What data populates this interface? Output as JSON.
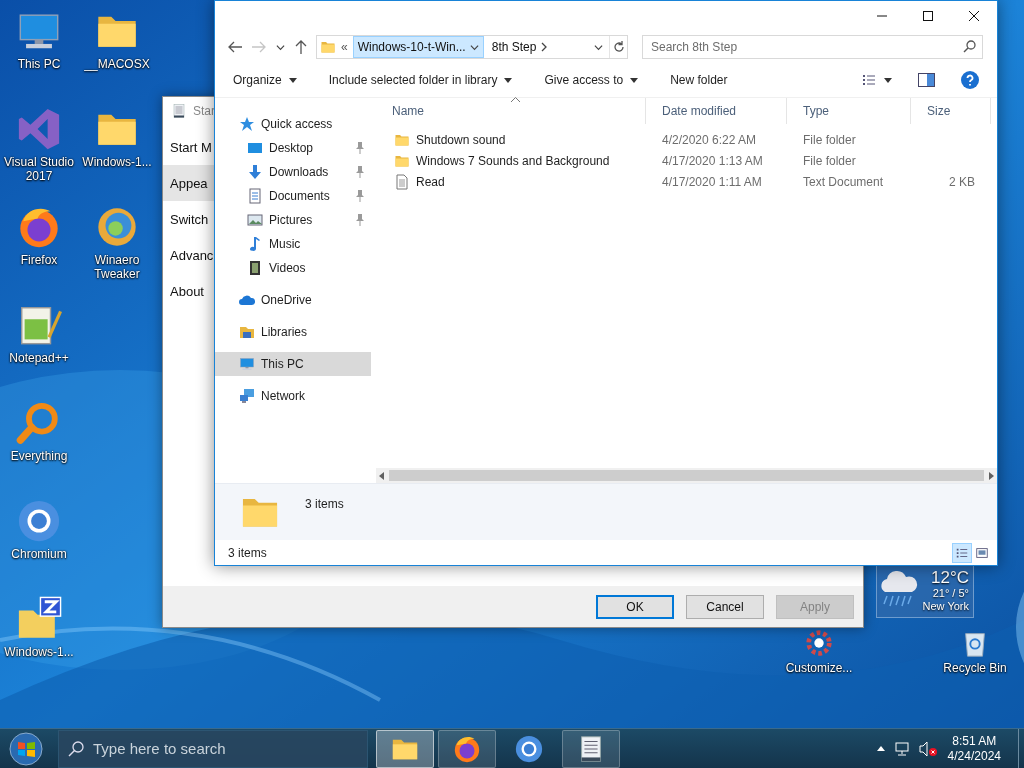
{
  "desktop_columns": [
    {
      "icons": [
        {
          "label": "This PC",
          "kind": "pc"
        },
        {
          "label": "Visual Studio 2017",
          "kind": "vs"
        },
        {
          "label": "Firefox",
          "kind": "firefox"
        },
        {
          "label": "Notepad++",
          "kind": "notepad"
        },
        {
          "label": "Everything",
          "kind": "search"
        },
        {
          "label": "Chromium",
          "kind": "chromium"
        },
        {
          "label": "Windows-1...",
          "kind": "zip"
        }
      ]
    },
    {
      "icons": [
        {
          "label": "__MACOSX",
          "kind": "folder"
        },
        {
          "label": "Windows-1...",
          "kind": "folder"
        },
        {
          "label": "Winaero Tweaker",
          "kind": "winaero"
        }
      ]
    }
  ],
  "desktop_icons_right": [
    {
      "label": "Customize...",
      "kind": "gear"
    },
    {
      "label": "Recycle Bin",
      "kind": "recycle"
    }
  ],
  "weather_widget": {
    "temperature": "12°C",
    "range": "21° / 5°",
    "city": "New York"
  },
  "background_dialog": {
    "title": "Star",
    "menu": [
      {
        "label": "Start M",
        "selected": false
      },
      {
        "label": "Appea",
        "selected": true
      },
      {
        "label": "Switch",
        "selected": false
      },
      {
        "label": "Advanc",
        "selected": false
      },
      {
        "label": "About",
        "selected": false
      }
    ],
    "buttons": [
      {
        "label": "OK",
        "default": true,
        "disabled": false
      },
      {
        "label": "Cancel",
        "default": false,
        "disabled": false
      },
      {
        "label": "Apply",
        "default": false,
        "disabled": true
      }
    ]
  },
  "explorer": {
    "address": {
      "overflow": "«",
      "crumbs": [
        {
          "label": "Windows-10-t-Win...",
          "selected": true
        },
        {
          "label": "8th Step",
          "selected": false
        }
      ]
    },
    "search": {
      "placeholder": "Search 8th Step"
    },
    "toolbar": [
      {
        "label": "Organize",
        "dropdown": true
      },
      {
        "label": "Include selected folder in library",
        "dropdown": true
      },
      {
        "label": "Give access to",
        "dropdown": true
      },
      {
        "label": "New folder",
        "dropdown": false
      }
    ],
    "nav_pane": [
      {
        "label": "Quick access",
        "kind": "star",
        "selected": false,
        "children": [
          {
            "label": "Desktop",
            "kind": "desktop",
            "pinned": true,
            "selected": false
          },
          {
            "label": "Downloads",
            "kind": "downloads",
            "pinned": true,
            "selected": false
          },
          {
            "label": "Documents",
            "kind": "documents",
            "pinned": true,
            "selected": false
          },
          {
            "label": "Pictures",
            "kind": "pictures",
            "pinned": true,
            "selected": false
          },
          {
            "label": "Music",
            "kind": "music",
            "pinned": false,
            "selected": false
          },
          {
            "label": "Videos",
            "kind": "videos",
            "pinned": false,
            "selected": false
          }
        ]
      },
      {
        "label": "OneDrive",
        "kind": "onedrive",
        "selected": false
      },
      {
        "label": "Libraries",
        "kind": "libraries",
        "selected": false
      },
      {
        "label": "This PC",
        "kind": "pc",
        "selected": true
      },
      {
        "label": "Network",
        "kind": "network",
        "selected": false
      }
    ],
    "columns": [
      {
        "label": "Name",
        "sorted": true
      },
      {
        "label": "Date modified",
        "sorted": false
      },
      {
        "label": "Type",
        "sorted": false
      },
      {
        "label": "Size",
        "sorted": false
      }
    ],
    "rows": [
      {
        "name": "Shutdown sound",
        "date": "4/2/2020 6:22 AM",
        "type": "File folder",
        "size": "",
        "kind": "folder"
      },
      {
        "name": "Windows 7 Sounds and Background",
        "date": "4/17/2020 1:13 AM",
        "type": "File folder",
        "size": "",
        "kind": "folder"
      },
      {
        "name": "Read",
        "date": "4/17/2020 1:11 AM",
        "type": "Text Document",
        "size": "2 KB",
        "kind": "text"
      }
    ],
    "details_pane": {
      "summary": "3 items"
    },
    "status_bar": {
      "text": "3 items",
      "views": [
        {
          "kind": "details",
          "selected": true
        },
        {
          "kind": "tiles",
          "selected": false
        }
      ]
    }
  },
  "taskbar": {
    "search_placeholder": "Type here to search",
    "apps": [
      {
        "kind": "explorer",
        "open": true,
        "active": true
      },
      {
        "kind": "firefox",
        "open": true,
        "active": false
      },
      {
        "kind": "chromium",
        "open": false,
        "active": false
      },
      {
        "kind": "window",
        "open": true,
        "active": false
      }
    ],
    "time": "8:51 AM",
    "date": "4/24/2024"
  }
}
